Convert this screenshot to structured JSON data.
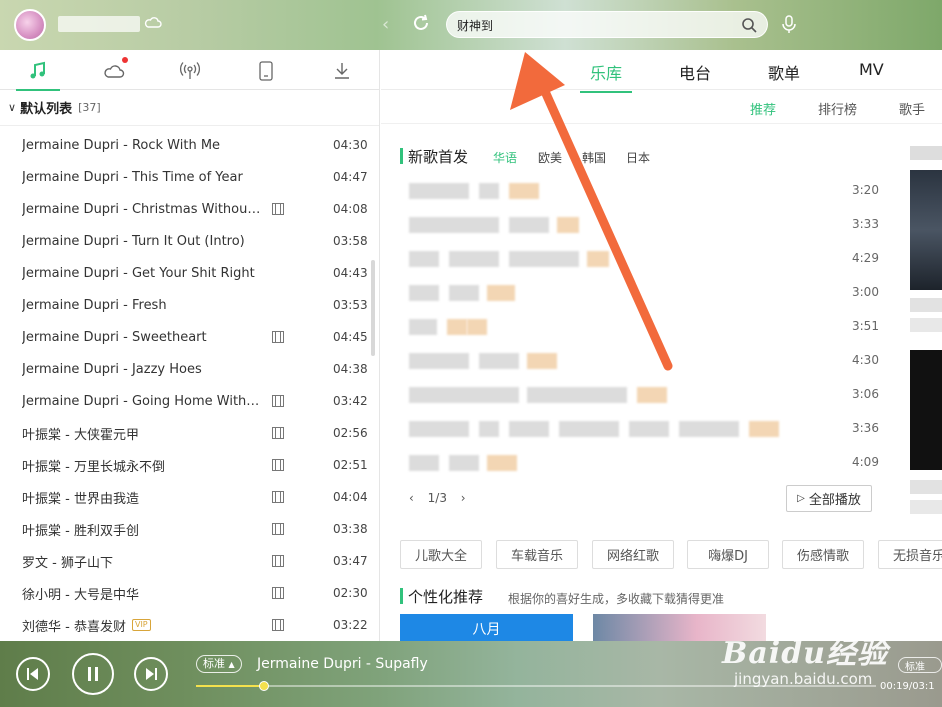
{
  "header": {
    "search_value": "财神到",
    "search_placeholder": ""
  },
  "left_tabs": [
    {
      "icon": "music-note-icon"
    },
    {
      "icon": "cloud-icon",
      "badge": "red-dot"
    },
    {
      "icon": "radio-signal-icon"
    },
    {
      "icon": "device-icon"
    },
    {
      "icon": "download-icon"
    }
  ],
  "playlist": {
    "title": "默认列表",
    "count": "[37]",
    "songs": [
      {
        "title": "Jermaine Dupri - Rock With Me",
        "duration": "04:30",
        "mv": false,
        "vip": ""
      },
      {
        "title": "Jermaine Dupri - This Time of Year",
        "duration": "04:47",
        "mv": false,
        "vip": ""
      },
      {
        "title": "Jermaine Dupri - Christmas Without ...",
        "duration": "04:08",
        "mv": true,
        "vip": ""
      },
      {
        "title": "Jermaine Dupri - Turn It Out (Intro)",
        "duration": "03:58",
        "mv": false,
        "vip": ""
      },
      {
        "title": "Jermaine Dupri - Get Your Shit Right",
        "duration": "04:43",
        "mv": false,
        "vip": ""
      },
      {
        "title": "Jermaine Dupri - Fresh",
        "duration": "03:53",
        "mv": false,
        "vip": ""
      },
      {
        "title": "Jermaine Dupri - Sweetheart",
        "duration": "04:45",
        "mv": true,
        "vip": ""
      },
      {
        "title": "Jermaine Dupri - Jazzy Hoes",
        "duration": "04:38",
        "mv": false,
        "vip": ""
      },
      {
        "title": "Jermaine Dupri - Going Home With ...",
        "duration": "03:42",
        "mv": true,
        "vip": ""
      },
      {
        "title": "叶振棠 - 大侠霍元甲",
        "duration": "02:56",
        "mv": true,
        "vip": ""
      },
      {
        "title": "叶振棠 - 万里长城永不倒",
        "duration": "02:51",
        "mv": true,
        "vip": ""
      },
      {
        "title": "叶振棠 - 世界由我造",
        "duration": "04:04",
        "mv": true,
        "vip": ""
      },
      {
        "title": "叶振棠 - 胜利双手创",
        "duration": "03:38",
        "mv": true,
        "vip": ""
      },
      {
        "title": "罗文 - 狮子山下",
        "duration": "03:47",
        "mv": true,
        "vip": ""
      },
      {
        "title": "徐小明 - 大号是中华",
        "duration": "02:30",
        "mv": true,
        "vip": ""
      },
      {
        "title": "刘德华 - 恭喜发财",
        "duration": "03:22",
        "mv": true,
        "vip": "VIP"
      }
    ]
  },
  "main_tabs": [
    "乐库",
    "电台",
    "歌单",
    "MV"
  ],
  "sub_tabs": [
    "推荐",
    "排行榜",
    "歌手"
  ],
  "new_songs": {
    "title": "新歌首发",
    "filters": [
      "华语",
      "欧美",
      "韩国",
      "日本"
    ],
    "durations": [
      "3:20",
      "3:33",
      "4:29",
      "3:00",
      "3:51",
      "4:30",
      "3:06",
      "3:36",
      "4:09"
    ],
    "page": "1/3",
    "play_all": "全部播放"
  },
  "tags": [
    "儿歌大全",
    "车载音乐",
    "网络红歌",
    "嗨爆DJ",
    "伤感情歌",
    "无损音乐"
  ],
  "personalized": {
    "title": "个性化推荐",
    "subtitle": "根据你的喜好生成，多收藏下载猜得更准",
    "card_label": "八月"
  },
  "player": {
    "quality_label": "标准",
    "now_playing": "Jermaine Dupri - Supafly",
    "progress": 0.1,
    "time": "00:19/03:1",
    "quality_label_right": "标准"
  },
  "watermark": {
    "main": "Baidu经验",
    "sub": "jingyan.baidu.com"
  },
  "colors": {
    "accent": "#31c27c",
    "annotation_arrow": "#f26a3c"
  }
}
